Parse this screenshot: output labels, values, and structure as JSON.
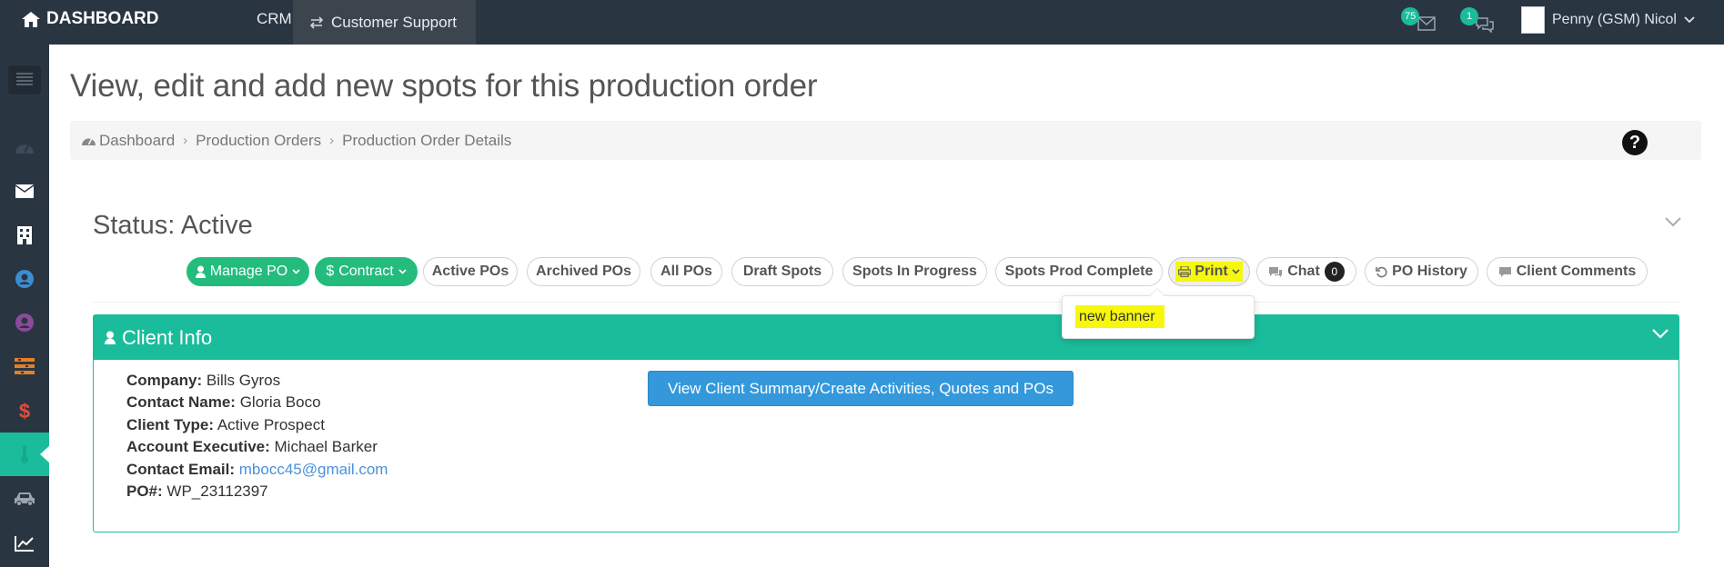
{
  "topbar": {
    "brand": "DASHBOARD",
    "nav_crm": "CRM",
    "nav_support": "Customer Support",
    "mail_count": "75",
    "chat_count": "1",
    "user_name": "Penny (GSM) Nicol"
  },
  "page": {
    "title": "View, edit and add new spots for this production order"
  },
  "breadcrumb": {
    "items": [
      "Dashboard",
      "Production Orders",
      "Production Order Details"
    ]
  },
  "status": {
    "label": "Status: Active"
  },
  "toolbar": {
    "manage_po": "Manage PO",
    "contract": "Contract",
    "active_pos": "Active POs",
    "archived_pos": "Archived POs",
    "all_pos": "All POs",
    "draft_spots": "Draft Spots",
    "spots_in_progress": "Spots In Progress",
    "spots_prod_complete": "Spots Prod Complete",
    "print": "Print",
    "chat": "Chat",
    "chat_count": "0",
    "po_history": "PO History",
    "client_comments": "Client Comments"
  },
  "print_menu": {
    "items": [
      "new banner"
    ]
  },
  "client_info": {
    "title": "Client Info",
    "company_label": "Company:",
    "company": "Bills Gyros",
    "contact_name_label": "Contact Name:",
    "contact_name": "Gloria Boco",
    "client_type_label": "Client Type:",
    "client_type": "Active Prospect",
    "account_exec_label": "Account Executive:",
    "account_exec": "Michael Barker",
    "contact_email_label": "Contact Email:",
    "contact_email": "mbocc45@gmail.com",
    "po_label": "PO#:",
    "po": "WP_23112397",
    "summary_button": "View Client Summary/Create Activities, Quotes and POs"
  },
  "colors": {
    "topbar": "#2a3542",
    "accent": "#1abc9c",
    "green_button": "#23bc7c",
    "primary_button": "#3498db",
    "highlight": "#f7f70c"
  }
}
